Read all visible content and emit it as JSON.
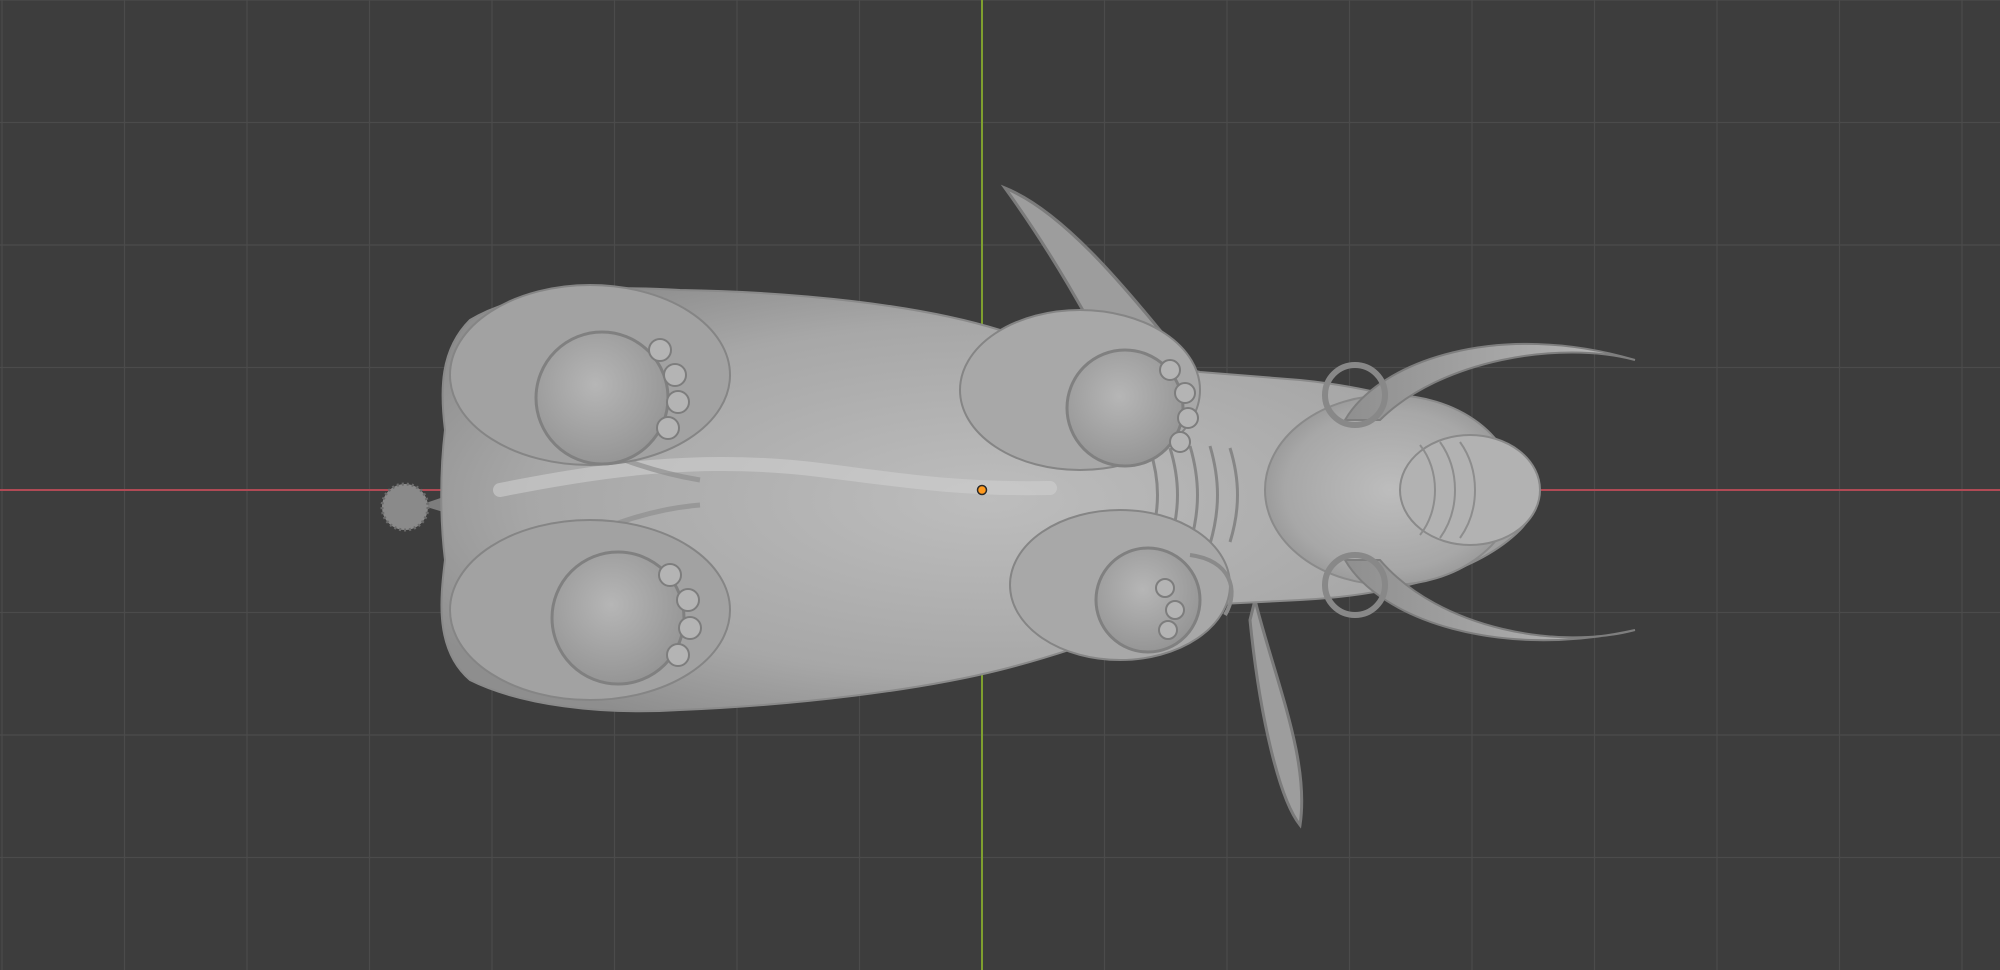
{
  "viewport": {
    "background": "#3d3d3d",
    "grid_color": "#4b4b4b",
    "x_axis_color": "#b04a55",
    "y_axis_color": "#7fa02f",
    "origin_color": "#ff9a1f"
  },
  "model": {
    "icon": "elephant-sculpt-icon",
    "body_color": "#a9a9a9"
  }
}
